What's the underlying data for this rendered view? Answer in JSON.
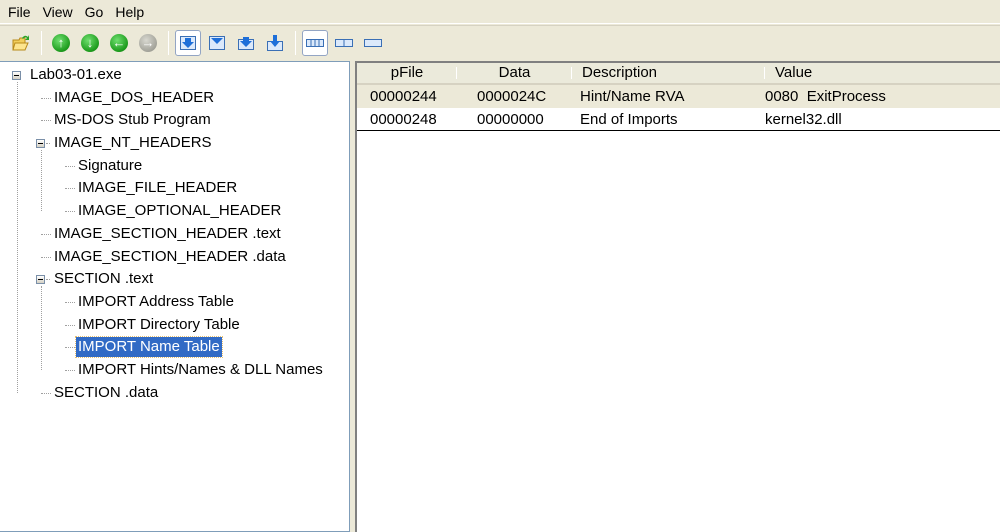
{
  "menu": [
    "File",
    "View",
    "Go",
    "Help"
  ],
  "toolbar": {
    "groups": [
      [
        "open-icon"
      ],
      [
        "up-arrow-icon",
        "down-arrow-icon",
        "back-arrow-icon",
        "forward-arrow-icon"
      ],
      [
        "view-detail-icon",
        "view-byte-icon",
        "view-word-icon",
        "view-dword-icon"
      ],
      [
        "columns-4-icon",
        "columns-2-icon",
        "columns-1-icon"
      ]
    ],
    "forward_disabled": true
  },
  "tree": {
    "items": [
      {
        "label": "Lab03-01.exe",
        "level": 0,
        "expandable": true
      },
      {
        "label": "IMAGE_DOS_HEADER",
        "level": 1
      },
      {
        "label": "MS-DOS Stub Program",
        "level": 1
      },
      {
        "label": "IMAGE_NT_HEADERS",
        "level": 1,
        "expandable": true
      },
      {
        "label": "Signature",
        "level": 2
      },
      {
        "label": "IMAGE_FILE_HEADER",
        "level": 2
      },
      {
        "label": "IMAGE_OPTIONAL_HEADER",
        "level": 2
      },
      {
        "label": "IMAGE_SECTION_HEADER .text",
        "level": 1
      },
      {
        "label": "IMAGE_SECTION_HEADER .data",
        "level": 1
      },
      {
        "label": "SECTION .text",
        "level": 1,
        "expandable": true
      },
      {
        "label": "IMPORT Address Table",
        "level": 2
      },
      {
        "label": "IMPORT Directory Table",
        "level": 2
      },
      {
        "label": "IMPORT Name Table",
        "level": 2,
        "selected": true
      },
      {
        "label": "IMPORT Hints/Names & DLL Names",
        "level": 2
      },
      {
        "label": "SECTION .data",
        "level": 1
      }
    ]
  },
  "table": {
    "columns": [
      "pFile",
      "Data",
      "Description",
      "Value"
    ],
    "rows": [
      [
        "00000244",
        "0000024C",
        "Hint/Name RVA",
        "0080  ExitProcess"
      ],
      [
        "00000248",
        "00000000",
        "End of Imports",
        "kernel32.dll"
      ]
    ]
  },
  "colors": {
    "selection": "#316ac5",
    "chrome": "#ece9d8"
  }
}
